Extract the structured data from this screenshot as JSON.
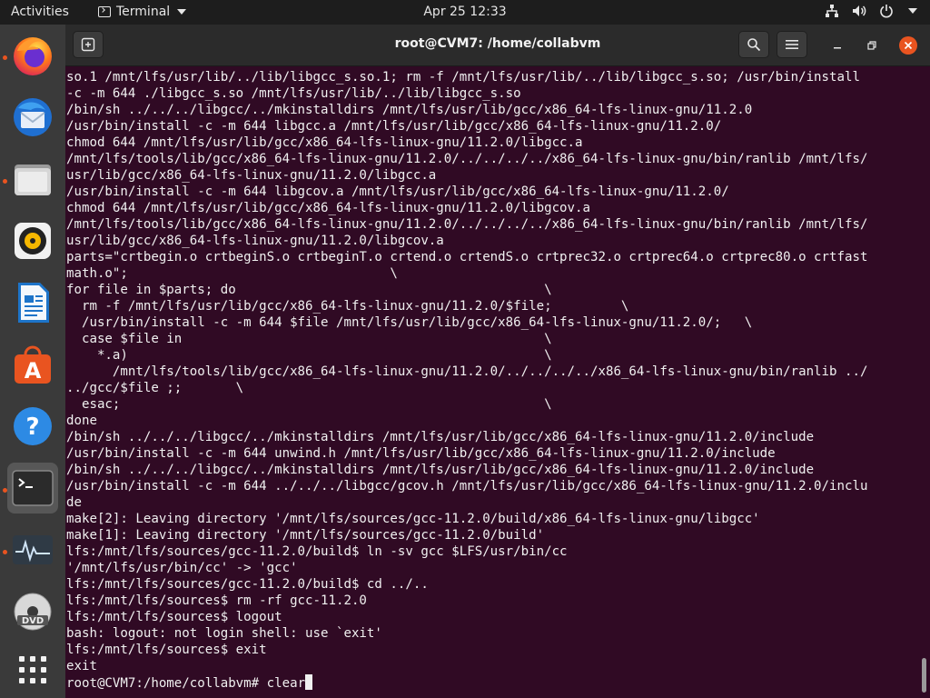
{
  "topbar": {
    "activities": "Activities",
    "app_name": "Terminal",
    "clock": "Apr 25  12:33",
    "tray_icons": [
      "network-icon",
      "volume-icon",
      "power-icon"
    ]
  },
  "dock": {
    "items": [
      {
        "name": "firefox",
        "running": true
      },
      {
        "name": "thunderbird",
        "running": false
      },
      {
        "name": "files",
        "running": true
      },
      {
        "name": "rhythmbox",
        "running": false
      },
      {
        "name": "libreoffice-writer",
        "running": false
      },
      {
        "name": "ubuntu-software",
        "running": false
      },
      {
        "name": "help",
        "running": false
      },
      {
        "name": "terminal",
        "running": true
      },
      {
        "name": "system-monitor",
        "running": true
      },
      {
        "name": "dvd-drive",
        "running": false
      },
      {
        "name": "show-applications",
        "running": false
      }
    ]
  },
  "window": {
    "title": "root@CVM7: /home/collabvm",
    "buttons": [
      "new-tab",
      "search",
      "menu",
      "minimize",
      "maximize",
      "close"
    ]
  },
  "terminal": {
    "lines": [
      "so.1 /mnt/lfs/usr/lib/../lib/libgcc_s.so.1; rm -f /mnt/lfs/usr/lib/../lib/libgcc_s.so; /usr/bin/install",
      "-c -m 644 ./libgcc_s.so /mnt/lfs/usr/lib/../lib/libgcc_s.so",
      "/bin/sh ../../../libgcc/../mkinstalldirs /mnt/lfs/usr/lib/gcc/x86_64-lfs-linux-gnu/11.2.0",
      "/usr/bin/install -c -m 644 libgcc.a /mnt/lfs/usr/lib/gcc/x86_64-lfs-linux-gnu/11.2.0/",
      "chmod 644 /mnt/lfs/usr/lib/gcc/x86_64-lfs-linux-gnu/11.2.0/libgcc.a",
      "/mnt/lfs/tools/lib/gcc/x86_64-lfs-linux-gnu/11.2.0/../../../../x86_64-lfs-linux-gnu/bin/ranlib /mnt/lfs/",
      "usr/lib/gcc/x86_64-lfs-linux-gnu/11.2.0/libgcc.a",
      "/usr/bin/install -c -m 644 libgcov.a /mnt/lfs/usr/lib/gcc/x86_64-lfs-linux-gnu/11.2.0/",
      "chmod 644 /mnt/lfs/usr/lib/gcc/x86_64-lfs-linux-gnu/11.2.0/libgcov.a",
      "/mnt/lfs/tools/lib/gcc/x86_64-lfs-linux-gnu/11.2.0/../../../../x86_64-lfs-linux-gnu/bin/ranlib /mnt/lfs/",
      "usr/lib/gcc/x86_64-lfs-linux-gnu/11.2.0/libgcov.a",
      "parts=\"crtbegin.o crtbeginS.o crtbeginT.o crtend.o crtendS.o crtprec32.o crtprec64.o crtprec80.o crtfast",
      "math.o\";                                  \\",
      "for file in $parts; do                                        \\",
      "  rm -f /mnt/lfs/usr/lib/gcc/x86_64-lfs-linux-gnu/11.2.0/$file;         \\",
      "  /usr/bin/install -c -m 644 $file /mnt/lfs/usr/lib/gcc/x86_64-lfs-linux-gnu/11.2.0/;   \\",
      "  case $file in                                               \\",
      "    *.a)                                                      \\",
      "      /mnt/lfs/tools/lib/gcc/x86_64-lfs-linux-gnu/11.2.0/../../../../x86_64-lfs-linux-gnu/bin/ranlib ../",
      "../gcc/$file ;;       \\",
      "  esac;                                                       \\",
      "done",
      "/bin/sh ../../../libgcc/../mkinstalldirs /mnt/lfs/usr/lib/gcc/x86_64-lfs-linux-gnu/11.2.0/include",
      "/usr/bin/install -c -m 644 unwind.h /mnt/lfs/usr/lib/gcc/x86_64-lfs-linux-gnu/11.2.0/include",
      "/bin/sh ../../../libgcc/../mkinstalldirs /mnt/lfs/usr/lib/gcc/x86_64-lfs-linux-gnu/11.2.0/include",
      "/usr/bin/install -c -m 644 ../../../libgcc/gcov.h /mnt/lfs/usr/lib/gcc/x86_64-lfs-linux-gnu/11.2.0/inclu",
      "de",
      "make[2]: Leaving directory '/mnt/lfs/sources/gcc-11.2.0/build/x86_64-lfs-linux-gnu/libgcc'",
      "make[1]: Leaving directory '/mnt/lfs/sources/gcc-11.2.0/build'",
      "lfs:/mnt/lfs/sources/gcc-11.2.0/build$ ln -sv gcc $LFS/usr/bin/cc",
      "'/mnt/lfs/usr/bin/cc' -> 'gcc'",
      "lfs:/mnt/lfs/sources/gcc-11.2.0/build$ cd ../..",
      "lfs:/mnt/lfs/sources$ rm -rf gcc-11.2.0",
      "lfs:/mnt/lfs/sources$ logout",
      "bash: logout: not login shell: use `exit'",
      "lfs:/mnt/lfs/sources$ exit",
      "exit"
    ],
    "prompt": "root@CVM7:/home/collabvm# ",
    "input": "clear"
  },
  "colors": {
    "terminal_bg": "#300a24",
    "accent": "#e95420",
    "close_button": "#e95420"
  }
}
